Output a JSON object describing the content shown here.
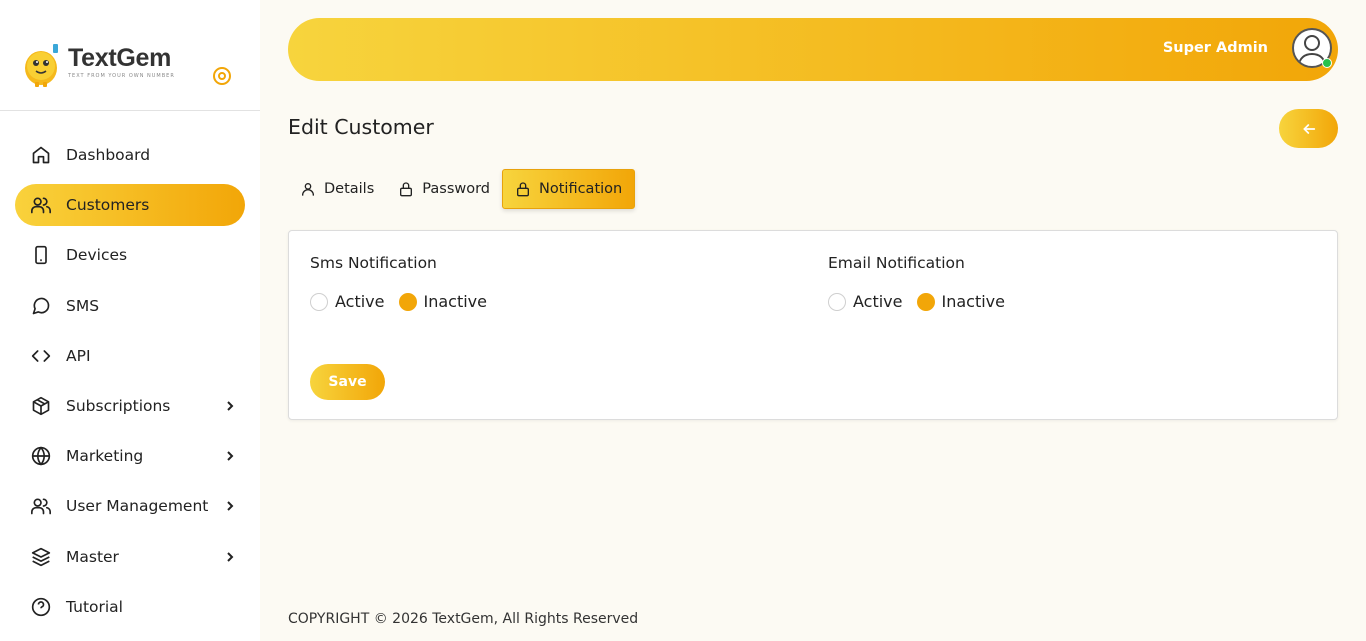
{
  "brand": {
    "name": "TextGem",
    "tagline": "TEXT FROM YOUR OWN NUMBER"
  },
  "sidebar": {
    "items": [
      {
        "label": "Dashboard",
        "icon": "home-icon",
        "active": false
      },
      {
        "label": "Customers",
        "icon": "users-icon",
        "active": true
      },
      {
        "label": "Devices",
        "icon": "smartphone-icon",
        "active": false
      },
      {
        "label": "SMS",
        "icon": "message-circle-icon",
        "active": false
      },
      {
        "label": "API",
        "icon": "code-icon",
        "active": false
      },
      {
        "label": "Subscriptions",
        "icon": "package-icon",
        "active": false,
        "has_submenu": true
      },
      {
        "label": "Marketing",
        "icon": "globe-icon",
        "active": false,
        "has_submenu": true
      },
      {
        "label": "User Management",
        "icon": "users-icon",
        "active": false,
        "has_submenu": true
      },
      {
        "label": "Master",
        "icon": "layers-icon",
        "active": false,
        "has_submenu": true
      },
      {
        "label": "Tutorial",
        "icon": "help-circle-icon",
        "active": false
      }
    ]
  },
  "header": {
    "user_name": "Super Admin",
    "status": "online"
  },
  "page": {
    "title": "Edit Customer",
    "back_icon": "arrow-left-icon"
  },
  "tabs": [
    {
      "label": "Details",
      "icon": "user-icon",
      "active": false
    },
    {
      "label": "Password",
      "icon": "lock-icon",
      "active": false
    },
    {
      "label": "Notification",
      "icon": "lock-icon",
      "active": true
    }
  ],
  "notifications": {
    "sms": {
      "title": "Sms Notification",
      "options": [
        {
          "label": "Active",
          "checked": false
        },
        {
          "label": "Inactive",
          "checked": true
        }
      ]
    },
    "email": {
      "title": "Email Notification",
      "options": [
        {
          "label": "Active",
          "checked": false
        },
        {
          "label": "Inactive",
          "checked": true
        }
      ]
    },
    "save_label": "Save"
  },
  "footer": {
    "text": "COPYRIGHT © 2026 TextGem, All Rights Reserved"
  },
  "colors": {
    "accent_start": "#f9d23c",
    "accent_end": "#f2a608",
    "background": "#fcfaf3",
    "online": "#27c24c"
  }
}
